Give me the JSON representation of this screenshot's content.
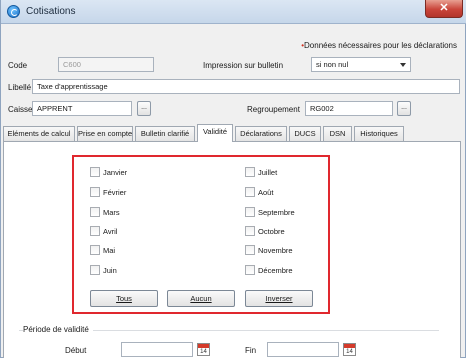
{
  "window": {
    "title": "Cotisations",
    "close_glyph": "✕"
  },
  "header": {
    "note_star": "•",
    "note_text": "Données nécessaires pour les déclarations"
  },
  "form": {
    "code_label": "Code",
    "code_value": "C600",
    "impression_label": "Impression sur bulletin",
    "impression_value": "si non nul",
    "libelle_label": "Libellé",
    "libelle_value": "Taxe d'apprentissage",
    "caisse_label": "Caisse",
    "caisse_value": "APPRENT",
    "regroupement_label": "Regroupement",
    "regroupement_value": "RG002",
    "ellipsis": "..."
  },
  "tabs": [
    {
      "label": "Eléments de calcul"
    },
    {
      "label": "Prise en compte"
    },
    {
      "label": "Bulletin clarifié"
    },
    {
      "label": "Validité"
    },
    {
      "label": "Déclarations"
    },
    {
      "label": "DUCS"
    },
    {
      "label": "DSN"
    },
    {
      "label": "Historiques"
    }
  ],
  "active_tab": "Validité",
  "months": {
    "left": [
      "Janvier",
      "Février",
      "Mars",
      "Avril",
      "Mai",
      "Juin"
    ],
    "right": [
      "Juillet",
      "Août",
      "Septembre",
      "Octobre",
      "Novembre",
      "Décembre"
    ]
  },
  "buttons": {
    "tous": "Tous",
    "aucun": "Aucun",
    "inverser": "Inverser"
  },
  "periode": {
    "label": "Période de validité",
    "debut_label": "Début",
    "fin_label": "Fin",
    "calendar_day": "14"
  },
  "colors": {
    "highlight": "#e0282e",
    "note_star": "#d0301f"
  }
}
